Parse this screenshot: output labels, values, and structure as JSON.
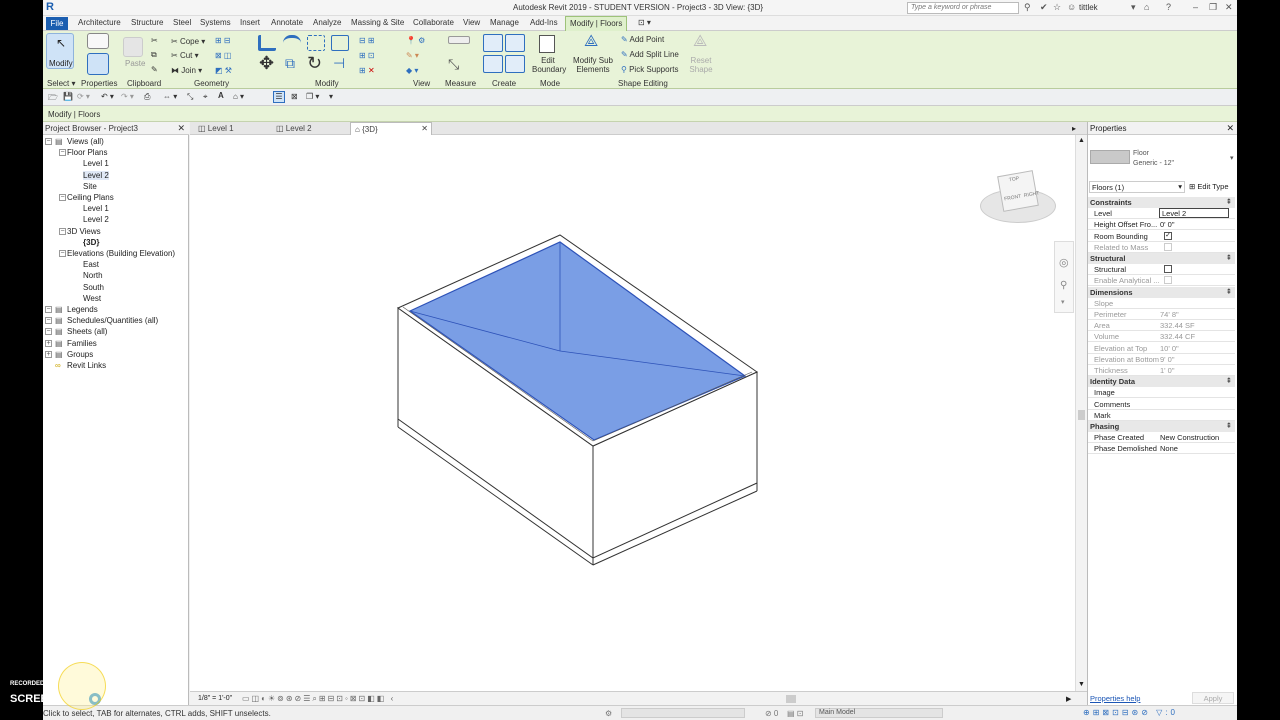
{
  "app": {
    "title": "Autodesk Revit 2019 - STUDENT VERSION - Project3 - 3D View: {3D}",
    "search_placeholder": "Type a keyword or phrase",
    "user": "tittlek"
  },
  "tabs": [
    "File",
    "Architecture",
    "Structure",
    "Steel",
    "Systems",
    "Insert",
    "Annotate",
    "Analyze",
    "Massing & Site",
    "Collaborate",
    "View",
    "Manage",
    "Add-Ins",
    "Modify | Floors"
  ],
  "ribbon": {
    "modify_label": "Modify",
    "clipboard_tools": [
      "Paste"
    ],
    "geometry_tools": [
      "Cope",
      "Cut",
      "Join"
    ],
    "mode_tools": [
      "Edit Boundary"
    ],
    "sub_elements": "Modify Sub Elements",
    "shape_tools": [
      "Add Point",
      "Add Split Line",
      "Pick Supports"
    ],
    "reset_shape": "Reset Shape",
    "panels": [
      "Select",
      "Properties",
      "Clipboard",
      "Geometry",
      "Modify",
      "View",
      "Measure",
      "Create",
      "Mode",
      "Shape Editing"
    ]
  },
  "context_bar": "Modify | Floors",
  "browser": {
    "title": "Project Browser - Project3",
    "nodes": [
      {
        "label": "Views (all)",
        "level": 0
      },
      {
        "label": "Floor Plans",
        "level": 1
      },
      {
        "label": "Level 1",
        "level": 2
      },
      {
        "label": "Level 2",
        "level": 2,
        "selected": true
      },
      {
        "label": "Site",
        "level": 2
      },
      {
        "label": "Ceiling Plans",
        "level": 1
      },
      {
        "label": "Level 1",
        "level": 2
      },
      {
        "label": "Level 2",
        "level": 2
      },
      {
        "label": "3D Views",
        "level": 1
      },
      {
        "label": "{3D}",
        "level": 2,
        "bold": true
      },
      {
        "label": "Elevations (Building Elevation)",
        "level": 1
      },
      {
        "label": "East",
        "level": 2
      },
      {
        "label": "North",
        "level": 2
      },
      {
        "label": "South",
        "level": 2
      },
      {
        "label": "West",
        "level": 2
      },
      {
        "label": "Legends",
        "level": 0
      },
      {
        "label": "Schedules/Quantities (all)",
        "level": 0
      },
      {
        "label": "Sheets (all)",
        "level": 0
      },
      {
        "label": "Families",
        "level": 0
      },
      {
        "label": "Groups",
        "level": 0
      },
      {
        "label": "Revit Links",
        "level": 0
      }
    ]
  },
  "view_tabs": [
    {
      "label": "Level 1"
    },
    {
      "label": "Level 2"
    },
    {
      "label": "{3D}",
      "active": true
    }
  ],
  "view_cube": {
    "top": "TOP",
    "front": "FRONT",
    "right": "RIGHT"
  },
  "view_control": {
    "scale": "1/8\" = 1'-0\""
  },
  "properties": {
    "title": "Properties",
    "family": "Floor",
    "type": "Generic - 12\"",
    "selector": "Floors (1)",
    "edit_type": "Edit Type",
    "sections": [
      {
        "name": "Constraints",
        "rows": [
          {
            "name": "Level",
            "value": "Level 2",
            "editing": true
          },
          {
            "name": "Height Offset Fro...",
            "value": "0' 0\""
          },
          {
            "name": "Room Bounding",
            "value": "",
            "checkbox": true,
            "checked": true
          },
          {
            "name": "Related to Mass",
            "value": "",
            "greyed": true,
            "checkbox": true
          }
        ]
      },
      {
        "name": "Structural",
        "rows": [
          {
            "name": "Structural",
            "value": "",
            "checkbox": true,
            "checked": false
          },
          {
            "name": "Enable Analytical ...",
            "value": "",
            "greyed": true,
            "checkbox": true
          }
        ]
      },
      {
        "name": "Dimensions",
        "rows": [
          {
            "name": "Slope",
            "value": "",
            "greyed": true
          },
          {
            "name": "Perimeter",
            "value": "74'  8\"",
            "greyed": true
          },
          {
            "name": "Area",
            "value": "332.44 SF",
            "greyed": true
          },
          {
            "name": "Volume",
            "value": "332.44 CF",
            "greyed": true
          },
          {
            "name": "Elevation at Top",
            "value": "10'  0\"",
            "greyed": true
          },
          {
            "name": "Elevation at Bottom",
            "value": "9'  0\"",
            "greyed": true
          },
          {
            "name": "Thickness",
            "value": "1'  0\"",
            "greyed": true
          }
        ]
      },
      {
        "name": "Identity Data",
        "rows": [
          {
            "name": "Image",
            "value": ""
          },
          {
            "name": "Comments",
            "value": ""
          },
          {
            "name": "Mark",
            "value": ""
          }
        ]
      },
      {
        "name": "Phasing",
        "rows": [
          {
            "name": "Phase Created",
            "value": "New Construction"
          },
          {
            "name": "Phase Demolished",
            "value": "None"
          }
        ]
      }
    ],
    "help": "Properties help",
    "apply": "Apply"
  },
  "status": {
    "text": "Click to select, TAB for alternates, CTRL adds, SHIFT unselects.",
    "model": "Main Model"
  },
  "watermark": {
    "line1": "RECORDED WITH",
    "line2": "SCREENCAST",
    "line3": "MATIC"
  }
}
